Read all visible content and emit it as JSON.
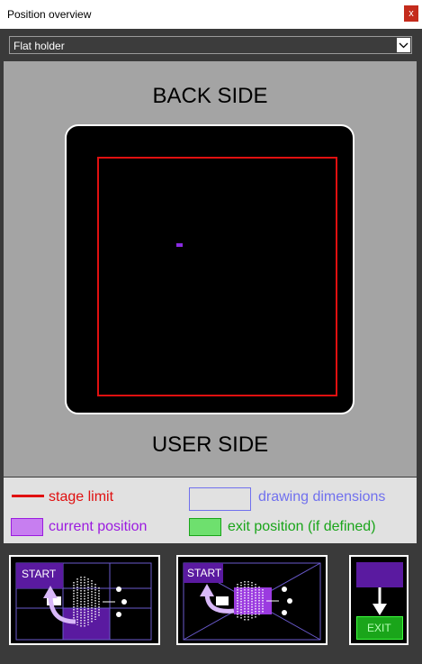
{
  "window": {
    "title": "Position overview",
    "close": "x"
  },
  "holder_select": {
    "value": "Flat holder"
  },
  "stage": {
    "back_label": "BACK SIDE",
    "user_label": "USER SIDE"
  },
  "legend": {
    "stage_limit": "stage limit",
    "drawing_dimensions": "drawing dimensions",
    "current_position": "current position",
    "exit_position": "exit position (if defined)"
  },
  "thumbnails": {
    "start_label": "START",
    "exit_label": "EXIT"
  },
  "colors": {
    "stage_limit": "#e01010",
    "drawing_dimensions": "#7070ee",
    "current_position": "#9b1be0",
    "exit_position": "#1aa51a"
  },
  "icons": [
    "close-icon",
    "chevron-down-icon",
    "start-arrow-icon",
    "exit-arrow-icon"
  ]
}
